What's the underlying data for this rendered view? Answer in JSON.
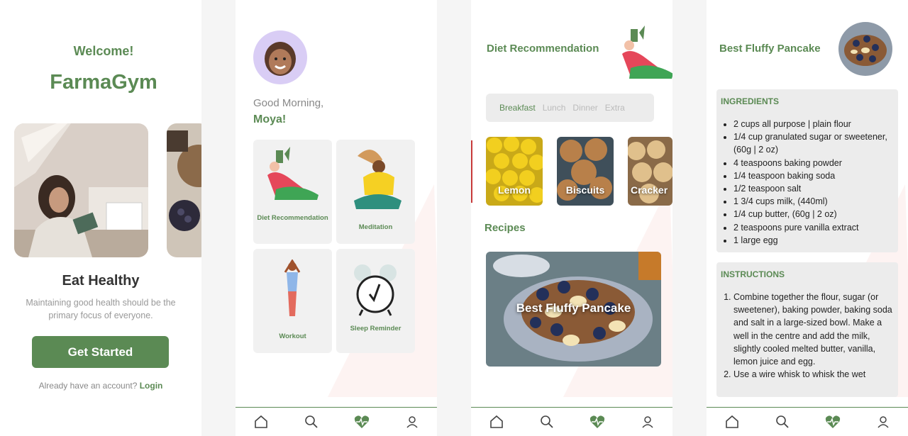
{
  "colors": {
    "accent": "#5b8a54",
    "text": "#333333",
    "muted": "#999999",
    "panel": "#ececec"
  },
  "screen1": {
    "welcome": "Welcome!",
    "brand": "FarmaGym",
    "heading": "Eat Healthy",
    "subtitle": "Maintaining good health should be the primary focus of everyone.",
    "cta": "Get Started",
    "login_prompt": "Already have an account?",
    "login_link": "Login"
  },
  "screen2": {
    "greeting": "Good Morning,",
    "username": "Moya!",
    "tiles": [
      {
        "label": "Diet Recommendation"
      },
      {
        "label": "Meditation"
      },
      {
        "label": "Workout"
      },
      {
        "label": "Sleep Reminder"
      }
    ]
  },
  "screen3": {
    "title": "Diet Recommendation",
    "tabs": [
      "Breakfast",
      "Lunch",
      "Dinner",
      "Extra"
    ],
    "active_tab": "Breakfast",
    "foods": [
      "Lemon",
      "Biscuits",
      "Cracker"
    ],
    "recipes_heading": "Recipes",
    "recipe_title": "Best Fluffy Pancake"
  },
  "screen4": {
    "title": "Best Fluffy Pancake",
    "ingredients_heading": "INGREDIENTS",
    "ingredients": [
      "2 cups all purpose | plain flour",
      "1/4 cup granulated sugar or sweetener, (60g | 2 oz)",
      "4 teaspoons baking powder",
      "1/4 teaspoon baking soda",
      "1/2 teaspoon salt",
      "1 3/4 cups milk, (440ml)",
      "1/4 cup butter, (60g | 2 oz)",
      "2 teaspoons pure vanilla extract",
      "1 large egg"
    ],
    "instructions_heading": "INSTRUCTIONS",
    "instructions": [
      "Combine together the flour, sugar (or sweetener), baking powder, baking soda and salt in a large-sized bowl. Make a well in the centre and add the milk, slightly cooled melted butter, vanilla, lemon juice and egg.",
      "Use a wire whisk to whisk the wet"
    ]
  },
  "nav_icons": [
    "home-icon",
    "search-icon",
    "heartbeat-icon",
    "user-icon"
  ]
}
